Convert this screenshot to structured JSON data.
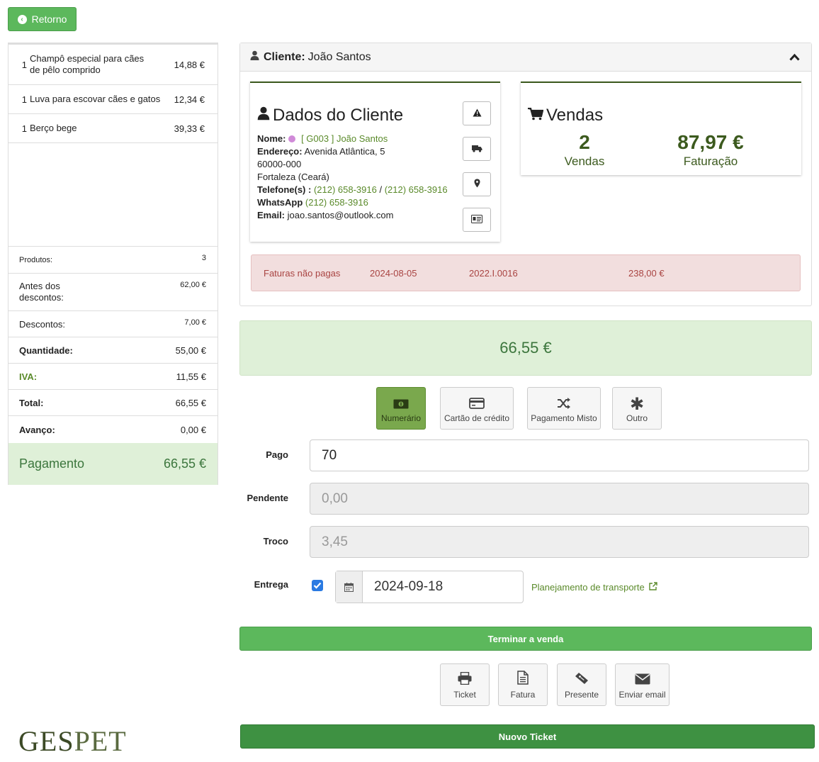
{
  "back_button": {
    "label": "Retorno"
  },
  "cart": {
    "items": [
      {
        "qty": "1",
        "name": "Champô especial para cães de pêlo comprido",
        "price": "14,88 €"
      },
      {
        "qty": "1",
        "name": "Luva para escovar cães e gatos",
        "price": "12,34 €"
      },
      {
        "qty": "1",
        "name": "Berço bege",
        "price": "39,33 €"
      }
    ],
    "summary": {
      "produtos_label": "Produtos:",
      "produtos_value": "3",
      "antes_label": "Antes dos descontos:",
      "antes_value": "62,00 €",
      "descontos_label": "Descontos:",
      "descontos_value": "7,00 €",
      "quantidade_label": "Quantidade:",
      "quantidade_value": "55,00 €",
      "iva_label": "IVA:",
      "iva_value": "11,55 €",
      "total_label": "Total:",
      "total_value": "66,55 €",
      "avanco_label": "Avanço:",
      "avanco_value": "0,00 €"
    },
    "payment": {
      "label": "Pagamento",
      "value": "66,55 €"
    }
  },
  "logo": {
    "text_a": "GES",
    "text_b": "PET"
  },
  "client": {
    "header_label": "Cliente:",
    "header_name": "João Santos",
    "dados": {
      "title": "Dados do Cliente",
      "nome_label": "Nome:",
      "nome_value": "[ G003 ] João Santos",
      "endereco_label": "Endereço:",
      "endereco_line1": "Avenida Atlântica, 5",
      "endereco_line2": "60000-000",
      "endereco_line3": "Fortaleza (Ceará)",
      "telefone_label": "Telefone(s) :",
      "telefone_1": "(212) 658-3916",
      "telefone_sep": " / ",
      "telefone_2": "(212) 658-3916",
      "whatsapp_label": "WhatsApp",
      "whatsapp_value": "(212) 658-3916",
      "email_label": "Email:",
      "email_value": "joao.santos@outlook.com"
    },
    "vendas": {
      "title": "Vendas",
      "count": "2",
      "count_label": "Vendas",
      "revenue": "87,97 €",
      "revenue_label": "Faturação"
    },
    "unpaid": {
      "label": "Faturas não pagas",
      "date": "2024-08-05",
      "number": "2022.I.0016",
      "amount": "238,00 €"
    }
  },
  "amount_due": "66,55 €",
  "payment_methods": [
    {
      "label": "Numerário",
      "active": true
    },
    {
      "label": "Cartão de crédito",
      "active": false
    },
    {
      "label": "Pagamento Misto",
      "active": false
    },
    {
      "label": "Outro",
      "active": false
    }
  ],
  "form": {
    "pago_label": "Pago",
    "pago_value": "70",
    "pendente_label": "Pendente",
    "pendente_value": "0,00",
    "troco_label": "Troco",
    "troco_value": "3,45",
    "entrega_label": "Entrega",
    "entrega_checked": true,
    "entrega_date": "2024-09-18",
    "transport_link": "Planejamento de transporte"
  },
  "finish_button": "Terminar a venda",
  "output_buttons": [
    "Ticket",
    "Fatura",
    "Presente",
    "Enviar email"
  ],
  "new_ticket_button": "Nuovo Ticket",
  "colors": {
    "green": "#5cb85c",
    "dark_green": "#3c5a1e",
    "success_bg": "#dff0d8",
    "danger_bg": "#f2dede",
    "link_green": "#5a8a2a"
  }
}
